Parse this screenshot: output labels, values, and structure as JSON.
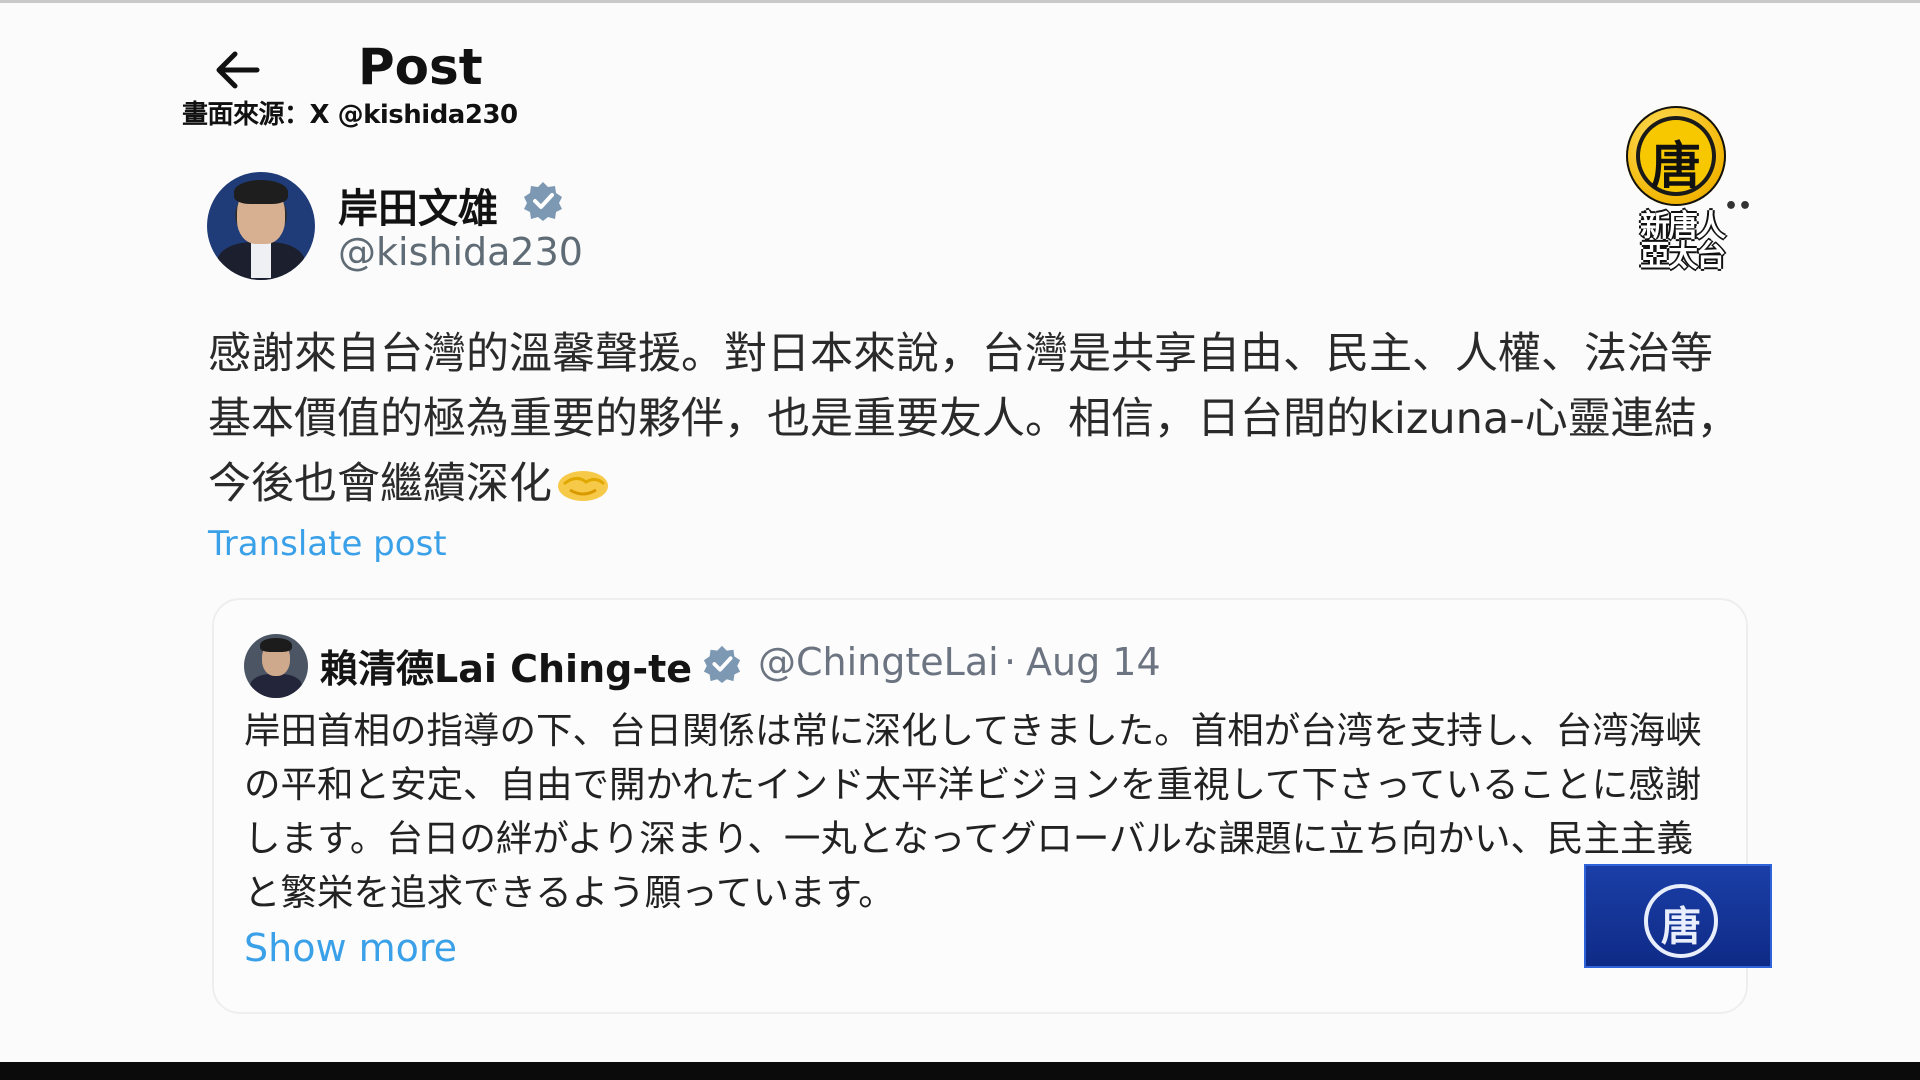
{
  "header": {
    "title": "Post",
    "source_credit": "畫面來源：X @kishida230"
  },
  "broadcaster": {
    "emblem_char": "唐",
    "name": "新唐人\n亞太台",
    "corner_emblem_char": "唐"
  },
  "post": {
    "author_name": "岸田文雄",
    "author_handle": "@kishida230",
    "verified": true,
    "text": "感謝來自台灣的溫馨聲援。對日本來說，台灣是共享自由、民主、人權、法治等基本價值的極為重要的夥伴，也是重要友人。相信，日台間的kizuna-心靈連結，今後也會繼續深化",
    "translate_label": "Translate post"
  },
  "quoted_post": {
    "author_name": "賴清德Lai Ching-te",
    "author_handle": "@ChingteLai",
    "separator": "·",
    "date": "Aug 14",
    "verified": true,
    "text": "岸田首相の指導の下、台日関係は常に深化してきました。首相が台湾を支持し、台湾海峡の平和と安定、自由で開かれたインド太平洋ビジョンを重視して下さっていることに感謝します。台日の絆がより深まり、一丸となってグローバルな課題に立ち向かい、民主主義と繁栄を追求できるよう願っています。",
    "show_more_label": "Show more"
  },
  "icons": {
    "back": "arrow-left-icon",
    "verified": "verified-badge-icon",
    "emoji": "handshake-icon"
  },
  "colors": {
    "link": "#3aa0e8",
    "verified": "#7c98b3",
    "badge_blue": "#1b3fa8",
    "logo_gold": "#f2b500"
  }
}
